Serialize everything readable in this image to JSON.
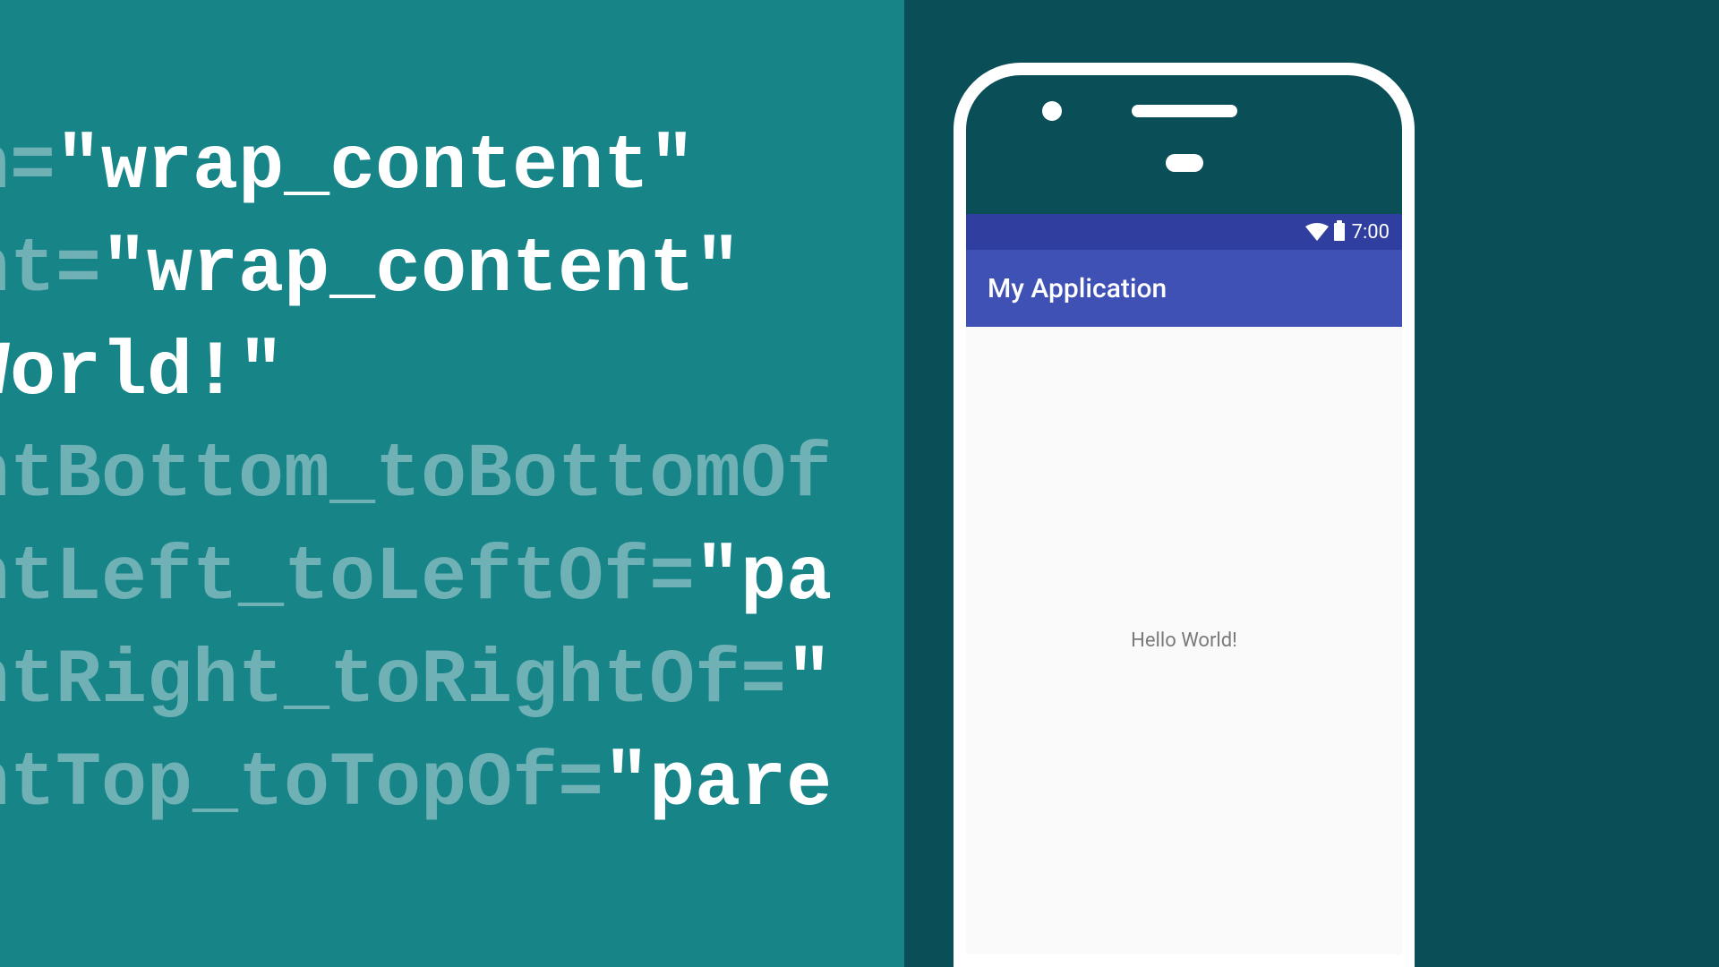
{
  "code": {
    "lines": [
      {
        "prefix": "h=",
        "value": "\"wrap_content\""
      },
      {
        "prefix": "ht=",
        "value": "\"wrap_content\""
      },
      {
        "prefix": "",
        "value": " World!\""
      },
      {
        "prefix": "htBottom_toBottomOf",
        "value": ""
      },
      {
        "prefix": "htLeft_toLeftOf=",
        "value": "\"pa"
      },
      {
        "prefix": "htRight_toRightOf=",
        "value": "\""
      },
      {
        "prefix": "htTop_toTopOf=",
        "value": "\"pare"
      }
    ]
  },
  "phone": {
    "status_time": "7:00",
    "app_title": "My Application",
    "content_text": "Hello World!"
  }
}
